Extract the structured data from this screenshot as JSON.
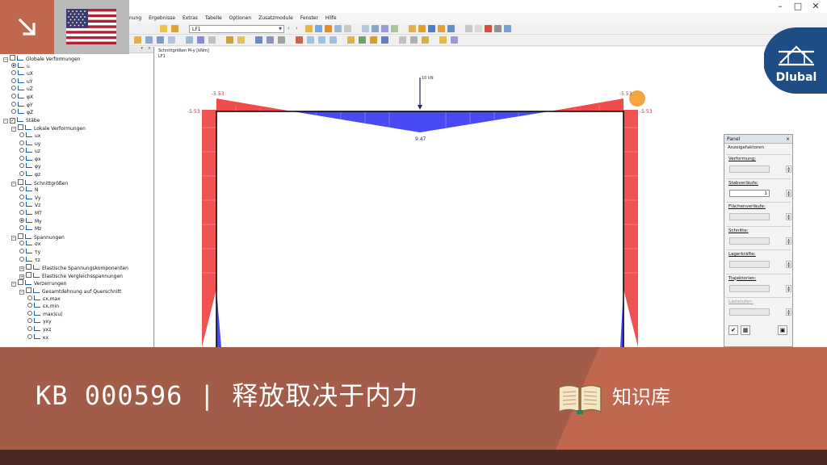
{
  "menubar": [
    "nung",
    "Ergebnisse",
    "Extras",
    "Tabelle",
    "Optionen",
    "Zusatzmodule",
    "Fenster",
    "Hilfe"
  ],
  "toolbar": {
    "loadcase": "LF1"
  },
  "tree": {
    "nodes": [
      {
        "label": "Globale Verformungen",
        "indent": 0,
        "kind": "root"
      },
      {
        "label": "u",
        "indent": 1,
        "kind": "radio",
        "on": true
      },
      {
        "label": "uX",
        "indent": 1,
        "kind": "radio"
      },
      {
        "label": "uY",
        "indent": 1,
        "kind": "radio"
      },
      {
        "label": "uZ",
        "indent": 1,
        "kind": "radio"
      },
      {
        "label": "φX",
        "indent": 1,
        "kind": "radio"
      },
      {
        "label": "φY",
        "indent": 1,
        "kind": "radio"
      },
      {
        "label": "φZ",
        "indent": 1,
        "kind": "radio"
      },
      {
        "label": "Stäbe",
        "indent": 0,
        "kind": "check",
        "on": true
      },
      {
        "label": "Lokale Verformungen",
        "indent": 1,
        "kind": "group"
      },
      {
        "label": "ux",
        "indent": 2,
        "kind": "radio"
      },
      {
        "label": "uy",
        "indent": 2,
        "kind": "radio"
      },
      {
        "label": "uz",
        "indent": 2,
        "kind": "radio"
      },
      {
        "label": "φx",
        "indent": 2,
        "kind": "radio"
      },
      {
        "label": "φy",
        "indent": 2,
        "kind": "radio"
      },
      {
        "label": "φz",
        "indent": 2,
        "kind": "radio"
      },
      {
        "label": "Schnittgrößen",
        "indent": 1,
        "kind": "group"
      },
      {
        "label": "N",
        "indent": 2,
        "kind": "radio"
      },
      {
        "label": "Vy",
        "indent": 2,
        "kind": "radio"
      },
      {
        "label": "Vz",
        "indent": 2,
        "kind": "radio"
      },
      {
        "label": "MT",
        "indent": 2,
        "kind": "radio"
      },
      {
        "label": "My",
        "indent": 2,
        "kind": "radio",
        "on": true
      },
      {
        "label": "Mz",
        "indent": 2,
        "kind": "radio"
      },
      {
        "label": "Spannungen",
        "indent": 1,
        "kind": "group"
      },
      {
        "label": "σx",
        "indent": 2,
        "kind": "radio"
      },
      {
        "label": "τy",
        "indent": 2,
        "kind": "radio"
      },
      {
        "label": "τz",
        "indent": 2,
        "kind": "radio"
      },
      {
        "label": "Elastische Spannungskomponenten",
        "indent": 2,
        "kind": "group"
      },
      {
        "label": "Elastische Vergleichsspannungen",
        "indent": 2,
        "kind": "group"
      },
      {
        "label": "Verzerrungen",
        "indent": 1,
        "kind": "group"
      },
      {
        "label": "Gesamtdehnung auf Querschnitt",
        "indent": 2,
        "kind": "group"
      },
      {
        "label": "εx,max",
        "indent": 3,
        "kind": "radio"
      },
      {
        "label": "εx,min",
        "indent": 3,
        "kind": "radio"
      },
      {
        "label": "max|εu|",
        "indent": 3,
        "kind": "radio"
      },
      {
        "label": "γxy",
        "indent": 3,
        "kind": "radio"
      },
      {
        "label": "γxz",
        "indent": 3,
        "kind": "radio"
      },
      {
        "label": "κx",
        "indent": 3,
        "kind": "radio"
      }
    ]
  },
  "diagram": {
    "header_line1": "Schnittgrößen M-y [kNm]",
    "header_line2": "LF1",
    "load_label": "10 kN",
    "values": {
      "left_corner_outer": "-5.53",
      "left_corner_inner": "-5.53",
      "right_corner_outer": "-5.53",
      "right_corner_inner": "-5.53",
      "midspan": "9.47"
    },
    "colors": {
      "negative": "#f04a4a",
      "positive": "#4a4af2",
      "frame": "#000000"
    }
  },
  "panel": {
    "title": "Panel",
    "subtitle": "Anzeigefaktoren",
    "groups": [
      {
        "label": "Verformung:",
        "value": "",
        "enabled": false
      },
      {
        "label": "Stabverläufe:",
        "value": "1",
        "enabled": true
      },
      {
        "label": "Flächenverläufe:",
        "value": "",
        "enabled": false
      },
      {
        "label": "Schnitte:",
        "value": "",
        "enabled": false
      },
      {
        "label": "Lagerkräfte:",
        "value": "",
        "enabled": false
      },
      {
        "label": "Trajektorien:",
        "value": "",
        "enabled": false
      },
      {
        "label": "Laststufen:",
        "value": "",
        "enabled": false
      }
    ]
  },
  "branding": {
    "dlubal_name": "Dlubal",
    "accent": "#c0674f"
  },
  "banner": {
    "title": "KB 000596 | 释放取决于内力",
    "library_label": "知识库"
  }
}
